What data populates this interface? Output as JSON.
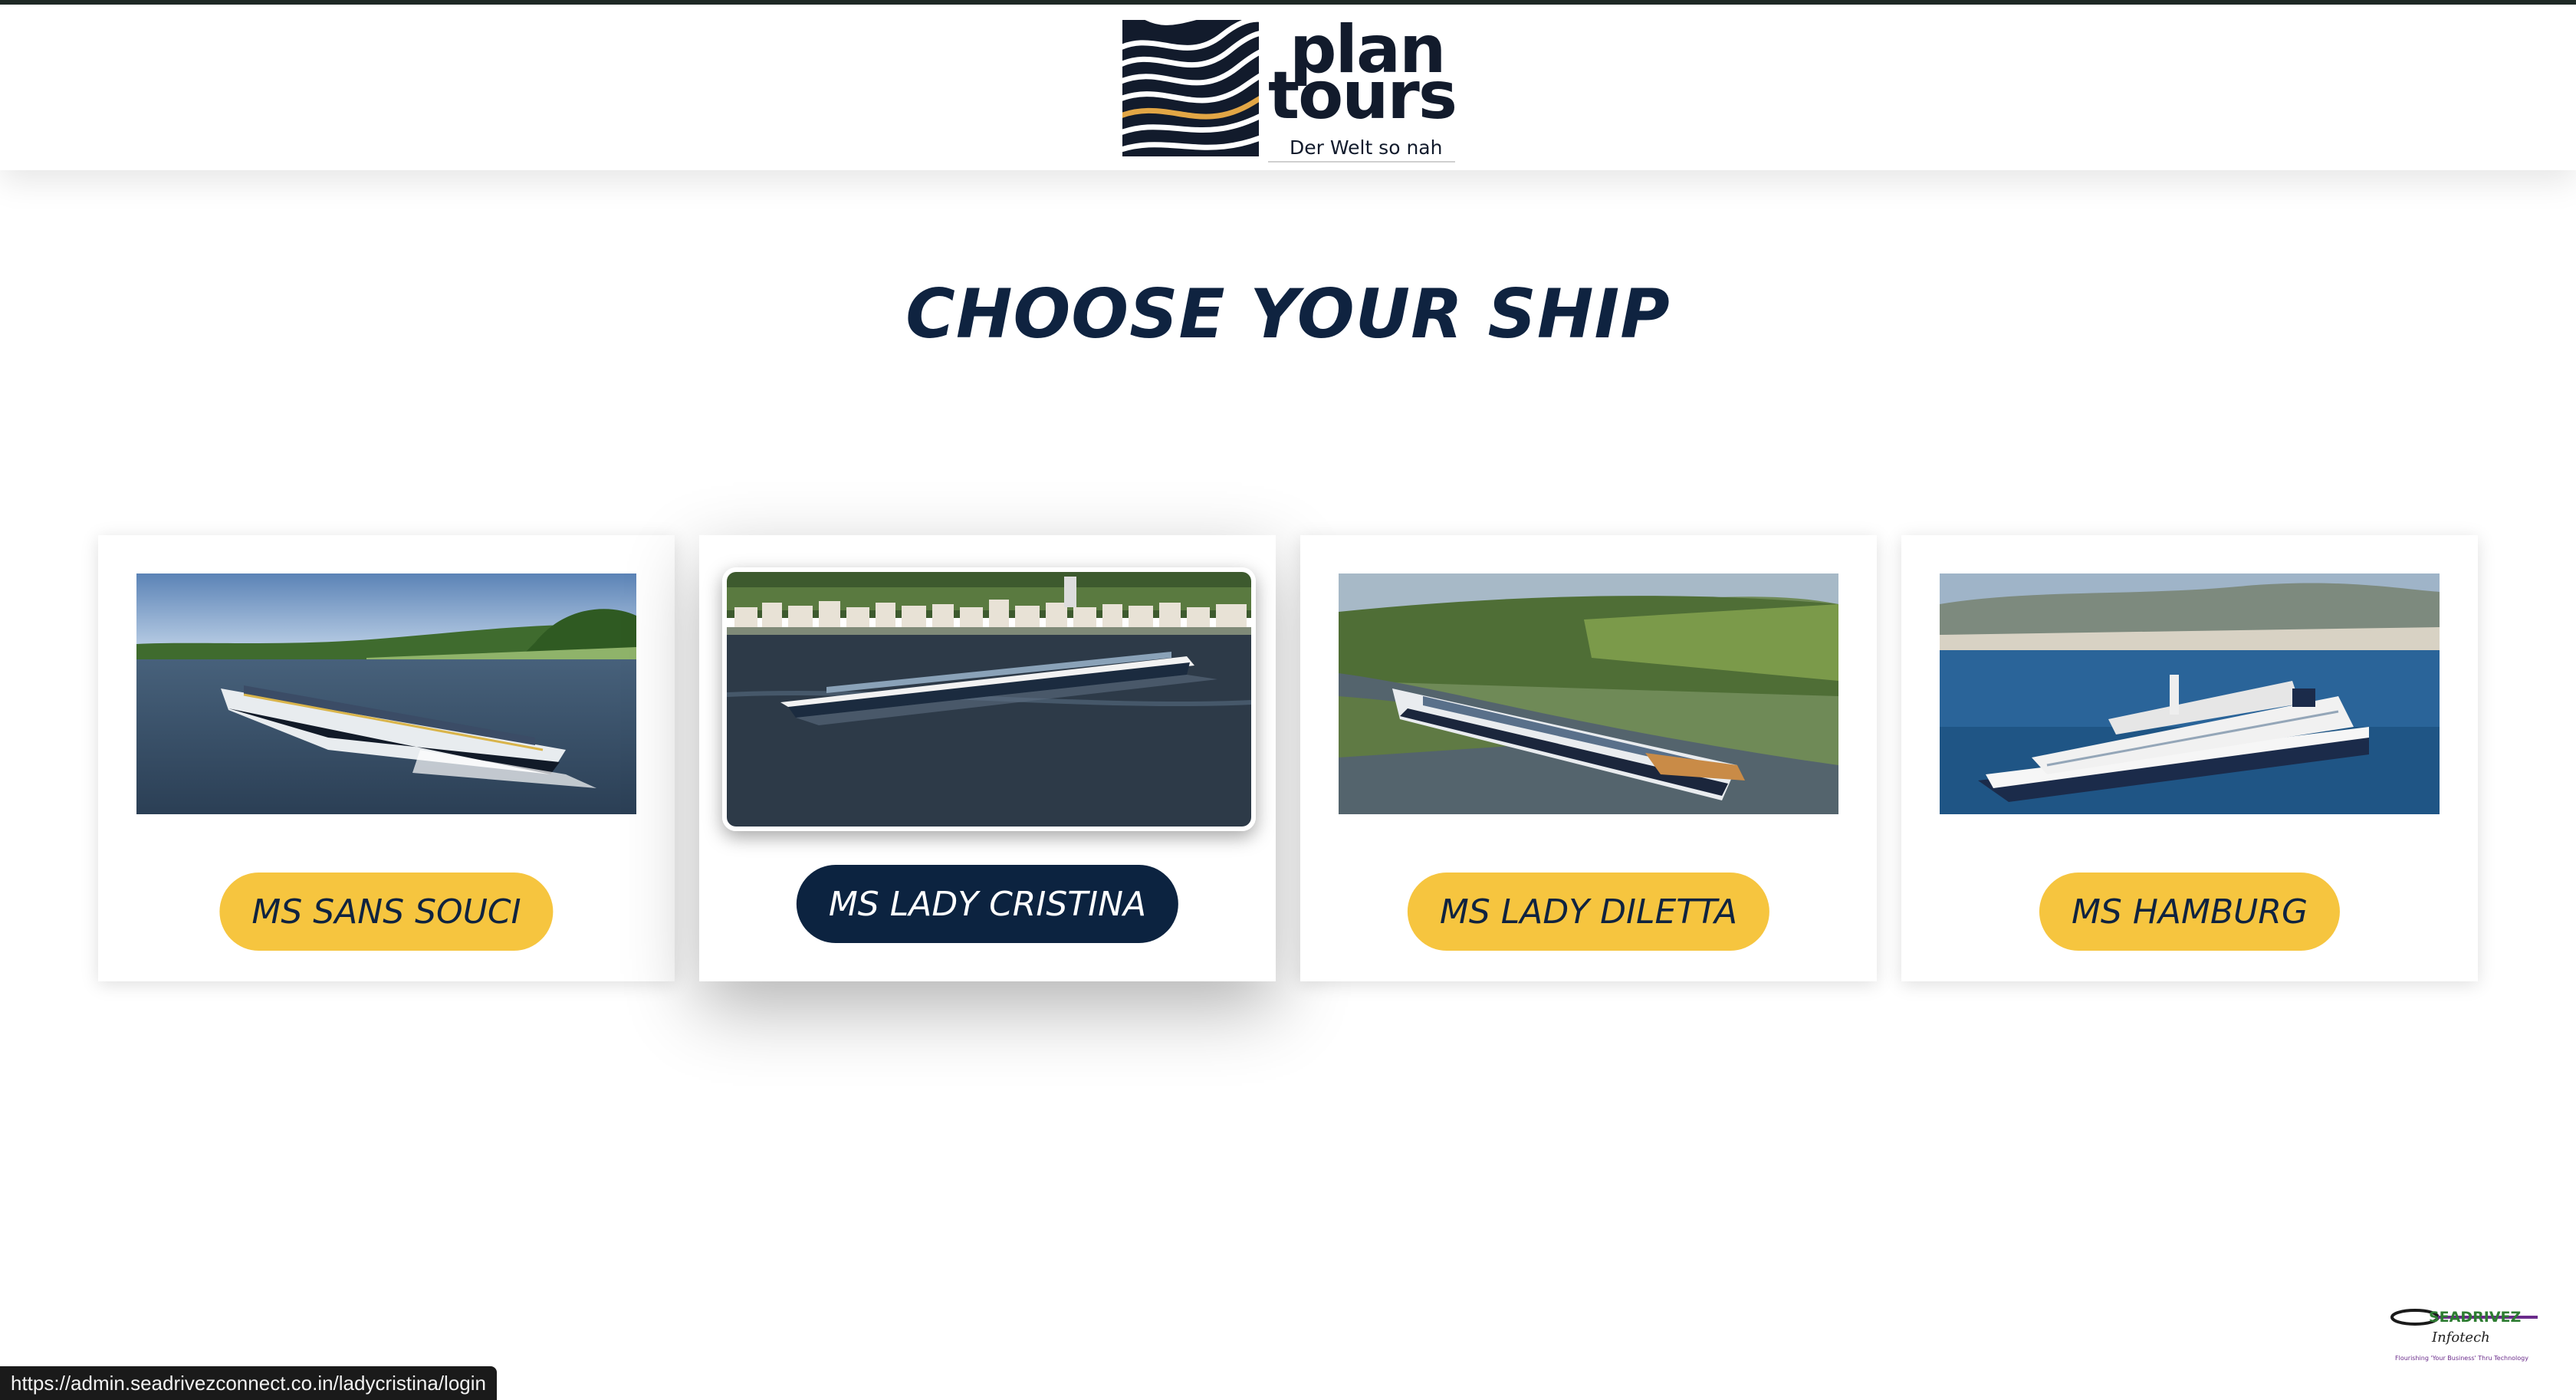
{
  "brand": {
    "name_line1": "plan",
    "name_line2": "tours",
    "tagline": "Der Welt so nah",
    "colors": {
      "navy": "#121b2c",
      "accent": "#e2a645"
    }
  },
  "page_title": "CHOOSE YOUR SHIP",
  "ships": [
    {
      "name": "MS SANS SOUCI",
      "image": "river-cruise-ship-photo"
    },
    {
      "name": "MS LADY CRISTINA",
      "image": "river-cruise-ship-photo",
      "active": true
    },
    {
      "name": "MS LADY DILETTA",
      "image": "river-cruise-ship-photo"
    },
    {
      "name": "MS HAMBURG",
      "image": "ocean-cruise-ship-photo"
    }
  ],
  "status_bar": {
    "url": "https://admin.seadrivezconnect.co.in/ladycristina/login"
  },
  "footer_logo": {
    "name": "SEADRIVEZ",
    "sub": "Infotech",
    "tagline": "Flourishing 'Your Business' Thru Technology"
  },
  "colors": {
    "button_yellow": "#f6c53f",
    "button_active": "#0c2340",
    "title": "#0f2340"
  }
}
